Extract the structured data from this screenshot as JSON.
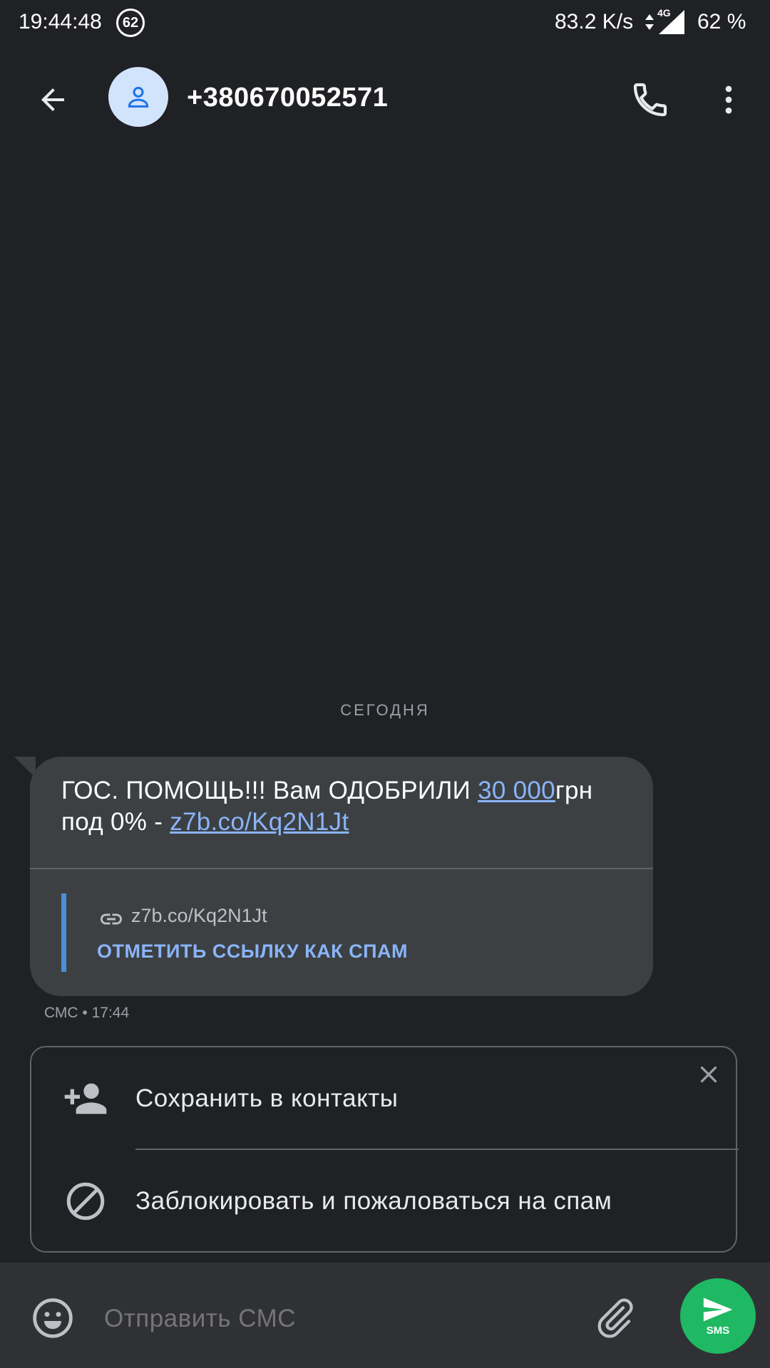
{
  "status_bar": {
    "time": "19:44:48",
    "notification_count": "62",
    "net_speed": "83.2 K/s",
    "network_type": "4G",
    "battery": "62 %"
  },
  "app_bar": {
    "contact_title": "+380670052571",
    "icons": [
      "back-arrow-icon",
      "person-icon",
      "phone-icon",
      "more-vert-icon"
    ]
  },
  "conversation": {
    "date_divider": "СЕГОДНЯ",
    "message": {
      "text_part1": "ГОС. ПОМОЩЬ!!! Вам ОДОБРИЛИ ",
      "amount_link": "30 000",
      "text_part2": "грн под 0% - ",
      "url_link": "z7b.co/Kq2N1Jt",
      "preview_url": "z7b.co/Kq2N1Jt",
      "mark_spam_label": "ОТМЕТИТЬ ССЫЛКУ КАК СПАМ",
      "meta": "СМС • 17:44"
    }
  },
  "suggestion_card": {
    "save_contact_label": "Сохранить в контакты",
    "block_label": "Заблокировать и пожаловаться на спам"
  },
  "compose": {
    "placeholder": "Отправить СМС",
    "send_label": "SMS"
  },
  "colors": {
    "background": "#202124",
    "bubble": "#3c4043",
    "link": "#8ab4f8",
    "send_button": "#1fb863",
    "avatar_bg": "#d2e3fc"
  }
}
